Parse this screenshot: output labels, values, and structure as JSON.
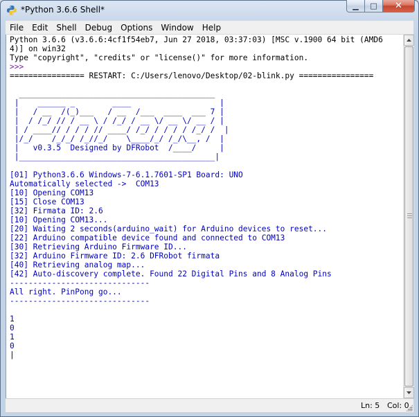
{
  "window": {
    "title": "*Python 3.6.6 Shell*",
    "minimize_glyph": "▁",
    "maximize_glyph": "□",
    "close_glyph": "✕",
    "icon": "python-icon"
  },
  "menu": {
    "items": [
      {
        "label": "File"
      },
      {
        "label": "Edit"
      },
      {
        "label": "Shell"
      },
      {
        "label": "Debug"
      },
      {
        "label": "Options"
      },
      {
        "label": "Window"
      },
      {
        "label": "Help"
      }
    ]
  },
  "shell": {
    "lines": [
      {
        "text": "Python 3.6.6 (v3.6.6:4cf1f54eb7, Jun 27 2018, 03:37:03) [MSC v.1900 64 bit (AMD6",
        "color": "black"
      },
      {
        "text": "4)] on win32",
        "color": "black"
      },
      {
        "text": "Type \"copyright\", \"credits\" or \"license()\" for more information.",
        "color": "black"
      },
      {
        "text": ">>> ",
        "color": "purple"
      },
      {
        "text": "================ RESTART: C:/Users/lenovo/Desktop/02-blink.py ================",
        "color": "black"
      },
      {
        "text": "",
        "color": "black"
      },
      {
        "text": "  __________________________________________",
        "color": "blue"
      },
      {
        "text": " |    ______ _        ____                   |",
        "color": "blue"
      },
      {
        "text": " |   / __  /(_)___   / __  /___  ____  ___ 7 |",
        "color": "blue"
      },
      {
        "text": " |  / /_/ // / __ \\ / /_/ / __ \\/ __ \\/ __ / |",
        "color": "blue"
      },
      {
        "text": " | / ____// / / / // ____/ /_/ / / / / /_/ /  |",
        "color": "blue"
      },
      {
        "text": " |/_/    /_/_/ /_//_/    \\____/_/ /_/\\__, /  |",
        "color": "blue"
      },
      {
        "text": " |   v0.3.5  Designed by DFRobot  /____/     |",
        "color": "blue"
      },
      {
        "text": " |__________________________________________|",
        "color": "blue"
      },
      {
        "text": "",
        "color": "black"
      },
      {
        "text": "[01] Python3.6.6 Windows-7-6.1.7601-SP1 Board: UNO",
        "color": "blue"
      },
      {
        "text": "Automatically selected ->  COM13",
        "color": "blue"
      },
      {
        "text": "[10] Opening COM13",
        "color": "blue"
      },
      {
        "text": "[15] Close COM13",
        "color": "blue"
      },
      {
        "text": "[32] Firmata ID: 2.6",
        "color": "blue"
      },
      {
        "text": "[10] Opening COM13...",
        "color": "blue"
      },
      {
        "text": "[20] Waiting 2 seconds(arduino_wait) for Arduino devices to reset...",
        "color": "blue"
      },
      {
        "text": "[22] Arduino compatible device found and connected to COM13",
        "color": "blue"
      },
      {
        "text": "[30] Retrieving Arduino Firmware ID...",
        "color": "blue"
      },
      {
        "text": "[32] Arduino Firmware ID: 2.6 DFRobot firmata",
        "color": "blue"
      },
      {
        "text": "[40] Retrieving analog map...",
        "color": "blue"
      },
      {
        "text": "[42] Auto-discovery complete. Found 22 Digital Pins and 8 Analog Pins",
        "color": "blue"
      },
      {
        "text": "------------------------------",
        "color": "blue"
      },
      {
        "text": "All right. PinPong go...",
        "color": "blue"
      },
      {
        "text": "------------------------------",
        "color": "blue"
      },
      {
        "text": "",
        "color": "black"
      },
      {
        "text": "1",
        "color": "blue"
      },
      {
        "text": "0",
        "color": "blue"
      },
      {
        "text": "1",
        "color": "blue"
      },
      {
        "text": "0",
        "color": "blue"
      },
      {
        "text": "|",
        "color": "black"
      }
    ]
  },
  "status": {
    "line": "Ln: 5",
    "col": "Col: 0"
  },
  "colors": {
    "output_blue": "#0000c0",
    "prompt_purple": "#7a1fa0",
    "text_black": "#000000"
  }
}
